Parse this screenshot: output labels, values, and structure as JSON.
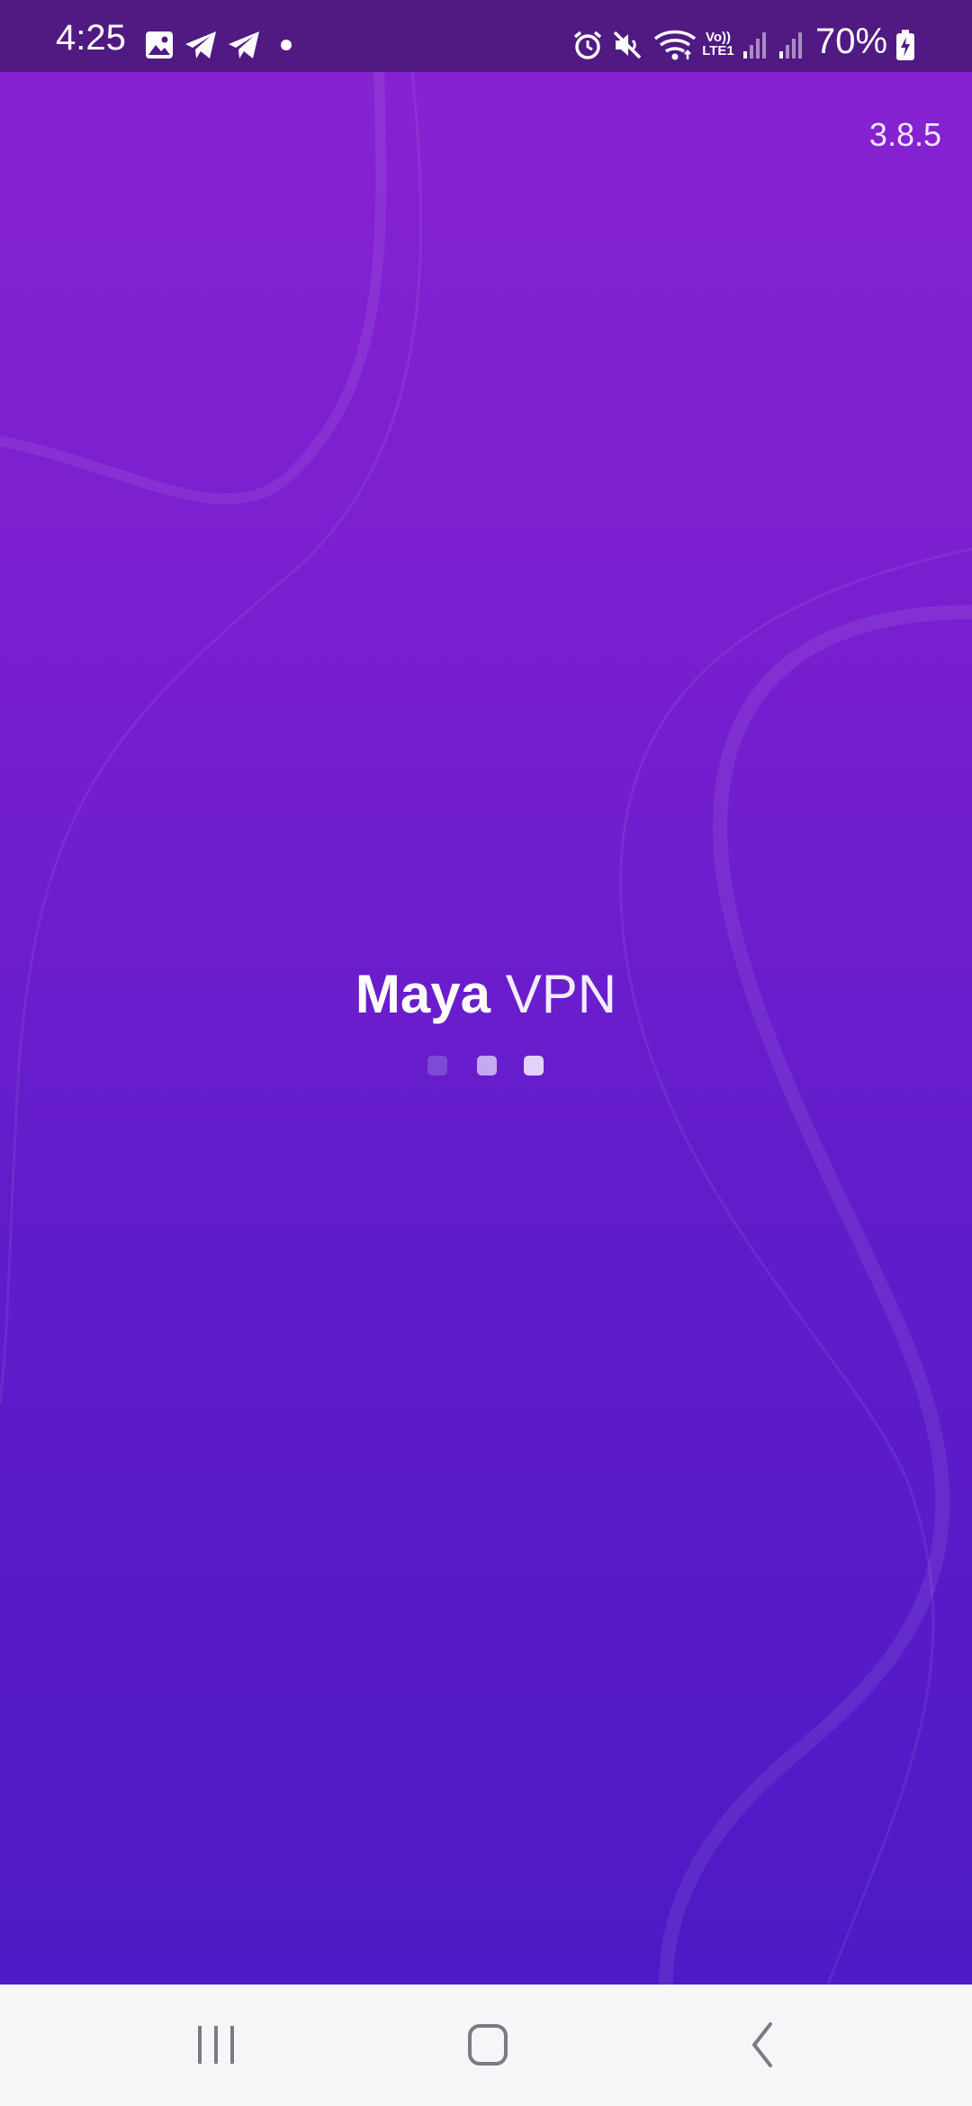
{
  "status_bar": {
    "time": "4:25",
    "battery_percent": "70%",
    "network_label_top": "Vo))",
    "network_label_bottom": "LTE1",
    "icons": [
      "gallery-icon",
      "telegram-icon",
      "telegram-icon",
      "dot-icon",
      "alarm-icon",
      "mute-icon",
      "wifi-icon",
      "signal-icon",
      "signal-icon",
      "battery-charging-icon"
    ]
  },
  "app": {
    "version": "3.8.5",
    "logo_bold": "Maya",
    "logo_light": "VPN"
  },
  "loader": {
    "dot_colors": [
      "#7b4ad6",
      "#c5a9ee",
      "#e1d2fa"
    ]
  },
  "nav_bar": {
    "icons": [
      "recents-icon",
      "home-icon",
      "back-icon"
    ]
  },
  "colors": {
    "background_top": "#8822d1",
    "background_bottom": "#4e19c6",
    "status_bar": "#511a82",
    "nav_bar": "#f5f6f8"
  }
}
